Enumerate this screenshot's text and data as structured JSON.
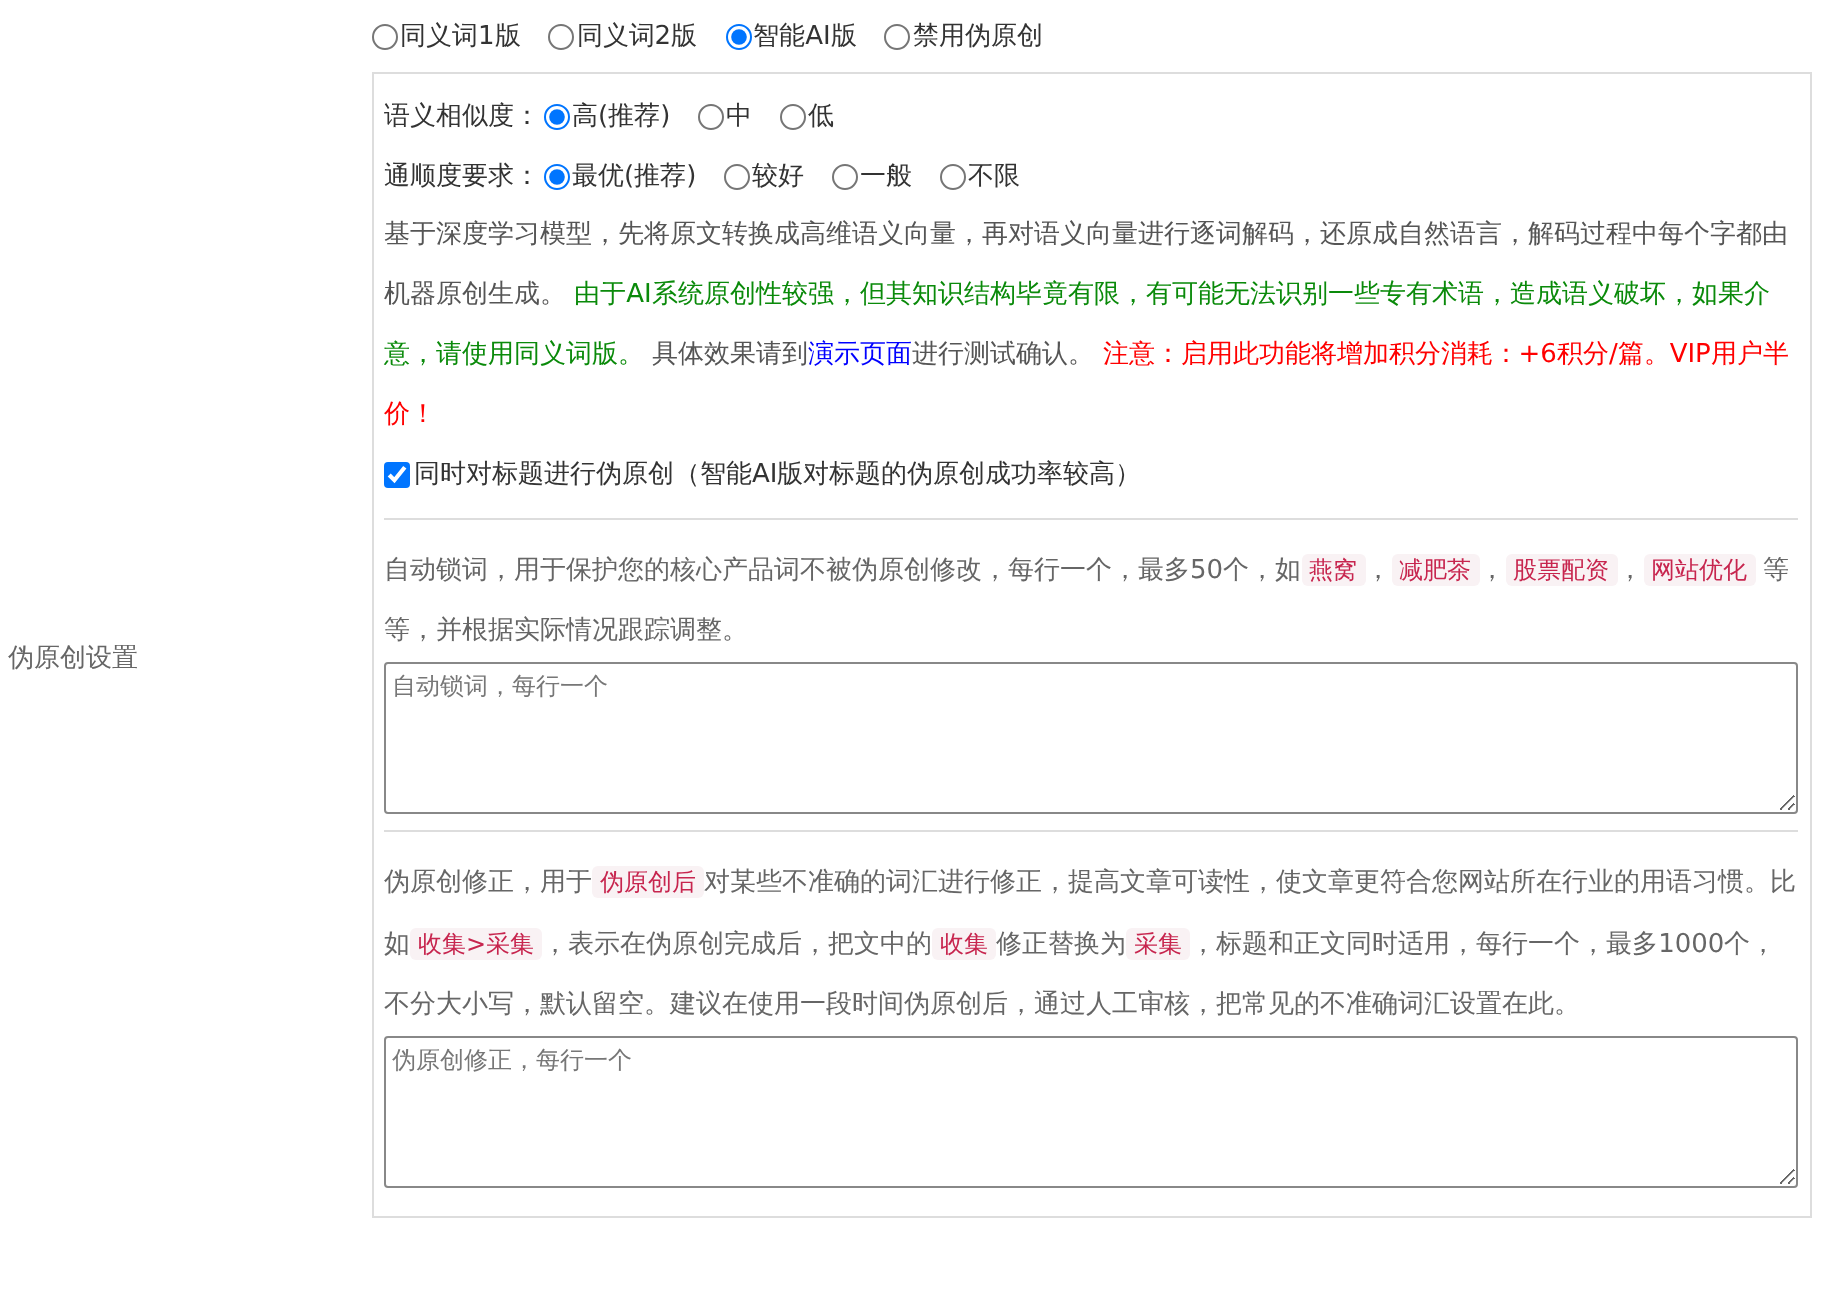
{
  "side_label": "伪原创设置",
  "modes": [
    {
      "label": "同义词1版",
      "selected": false
    },
    {
      "label": "同义词2版",
      "selected": false
    },
    {
      "label": "智能AI版",
      "selected": true
    },
    {
      "label": "禁用伪原创",
      "selected": false
    }
  ],
  "option_groups": [
    {
      "label": "语义相似度：",
      "options": [
        {
          "label": "高(推荐)",
          "selected": true
        },
        {
          "label": "中",
          "selected": false
        },
        {
          "label": "低",
          "selected": false
        }
      ]
    },
    {
      "label": "通顺度要求：",
      "options": [
        {
          "label": "最优(推荐)",
          "selected": true
        },
        {
          "label": "较好",
          "selected": false
        },
        {
          "label": "一般",
          "selected": false
        },
        {
          "label": "不限",
          "selected": false
        }
      ]
    }
  ],
  "description": [
    {
      "kind": "plain",
      "text": "基于深度学习模型，先将原文转换成高维语义向量，再对语义向量进行逐词解码，还原成自然语言，解码过程中每个字都由机器原创生成。 "
    },
    {
      "kind": "green",
      "text": "由于AI系统原创性较强，但其知识结构毕竟有限，有可能无法识别一些专有术语，造成语义破坏，如果介意，请使用同义词版。"
    },
    {
      "kind": "plain",
      "text": " 具体效果请到"
    },
    {
      "kind": "link",
      "text": "演示页面"
    },
    {
      "kind": "plain",
      "text": "进行测试确认。 "
    },
    {
      "kind": "red",
      "text": "注意：启用此功能将增加积分消耗：+6积分/篇。VIP用户半价！"
    }
  ],
  "title_option": {
    "label": "同时对标题进行伪原创（智能AI版对标题的伪原创成功率较高）",
    "checked": true
  },
  "lock_words": {
    "description": [
      {
        "kind": "plain",
        "text": "自动锁词，用于保护您的核心产品词不被伪原创修改，每行一个，最多50个，如"
      },
      {
        "kind": "code",
        "text": "燕窝"
      },
      {
        "kind": "plain",
        "text": "，"
      },
      {
        "kind": "code",
        "text": "减肥茶"
      },
      {
        "kind": "plain",
        "text": "，"
      },
      {
        "kind": "code",
        "text": "股票配资"
      },
      {
        "kind": "plain",
        "text": "，"
      },
      {
        "kind": "code",
        "text": "网站优化"
      },
      {
        "kind": "plain",
        "text": " 等等，并根据实际情况跟踪调整。"
      }
    ],
    "placeholder": "自动锁词，每行一个"
  },
  "corrections": {
    "description": [
      {
        "kind": "plain",
        "text": "伪原创修正，用于"
      },
      {
        "kind": "code",
        "text": "伪原创后"
      },
      {
        "kind": "plain",
        "text": "对某些不准确的词汇进行修正，提高文章可读性，使文章更符合您网站所在行业的用语习惯。比如"
      },
      {
        "kind": "code",
        "text": "收集>采集"
      },
      {
        "kind": "plain",
        "text": "，表示在伪原创完成后，把文中的"
      },
      {
        "kind": "code",
        "text": "收集"
      },
      {
        "kind": "plain",
        "text": "修正替换为"
      },
      {
        "kind": "code",
        "text": "采集"
      },
      {
        "kind": "plain",
        "text": "，标题和正文同时适用，每行一个，最多1000个，不分大小写，默认留空。建议在使用一段时间伪原创后，通过人工审核，把常见的不准确词汇设置在此。"
      }
    ],
    "placeholder": "伪原创修正，每行一个"
  }
}
